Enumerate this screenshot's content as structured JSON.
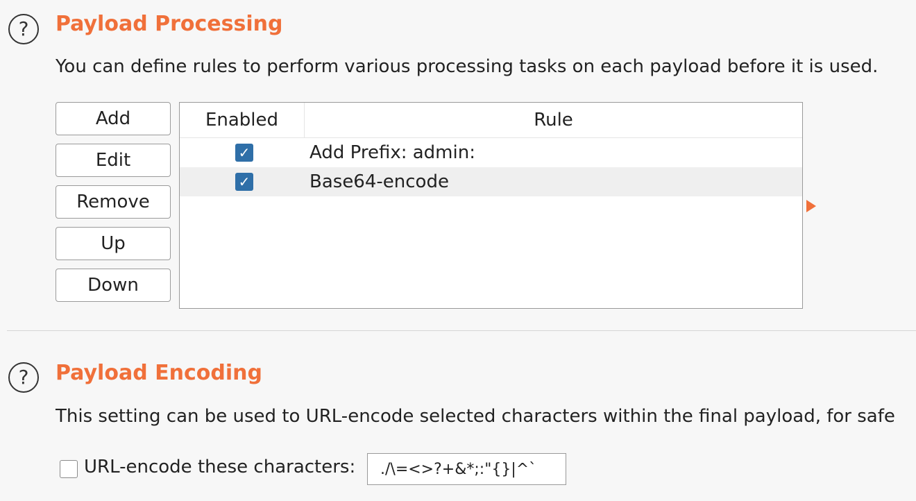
{
  "processing": {
    "help_glyph": "?",
    "title": "Payload Processing",
    "description": "You can define rules to perform various processing tasks on each payload before it is used.",
    "buttons": {
      "add": "Add",
      "edit": "Edit",
      "remove": "Remove",
      "up": "Up",
      "down": "Down"
    },
    "table": {
      "columns": [
        "Enabled",
        "Rule"
      ],
      "rows": [
        {
          "enabled": true,
          "rule": "Add Prefix: admin:"
        },
        {
          "enabled": true,
          "rule": "Base64-encode"
        }
      ]
    }
  },
  "encoding": {
    "help_glyph": "?",
    "title": "Payload Encoding",
    "description": "This setting can be used to URL-encode selected characters within the final payload, for safe",
    "url_encode_checked": false,
    "url_encode_label": "URL-encode these characters:",
    "characters_value": "./\\=<>?+&*;:\"{}|^`"
  },
  "colors": {
    "accent": "#f0703a",
    "checkbox": "#2f6fa8",
    "selected_row": "#efefef"
  },
  "icons": {
    "help": "help-circle-icon",
    "checkbox_checked": "checkmark-icon",
    "side_arrow": "triangle-right-icon"
  }
}
